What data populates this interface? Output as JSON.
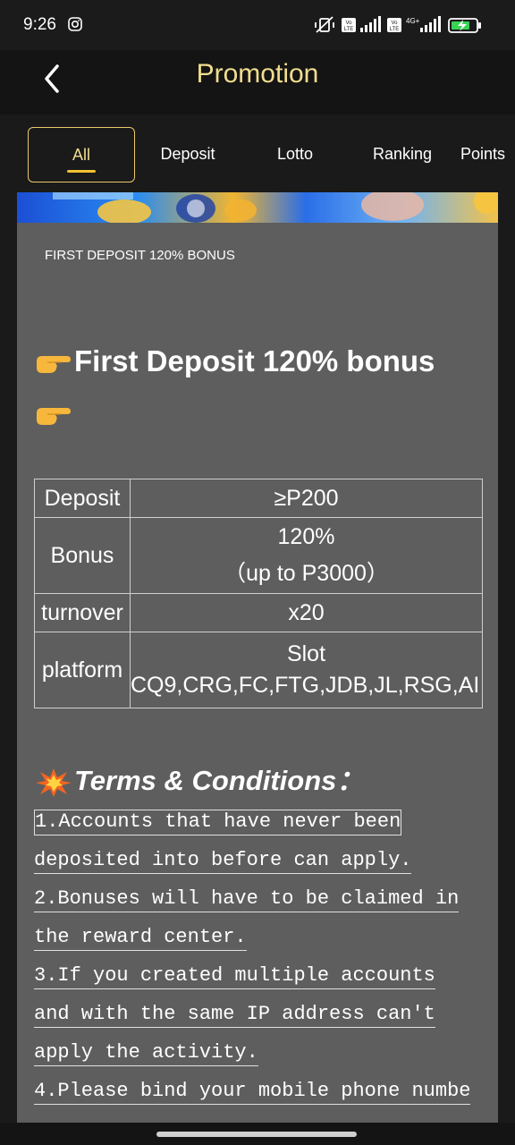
{
  "status_bar": {
    "time": "9:26"
  },
  "header": {
    "title": "Promotion",
    "title_color": "#f1dd8f"
  },
  "tabs": [
    {
      "label": "All",
      "active": true
    },
    {
      "label": "Deposit",
      "active": false
    },
    {
      "label": "Lotto",
      "active": false
    },
    {
      "label": "Ranking",
      "active": false
    },
    {
      "label": "Points",
      "active": false
    }
  ],
  "promo": {
    "heading": "FIRST DEPOSIT 120% BONUS",
    "title": "First Deposit 120% bonus",
    "table": {
      "deposit_label": "Deposit",
      "deposit_value": "≥P200",
      "bonus_label": "Bonus",
      "bonus_value_line1": "120%",
      "bonus_value_line2": "（up to P3000）",
      "turnover_label": "turnover",
      "turnover_value": "x20",
      "platform_label": "platform",
      "platform_value_line1": "Slot",
      "platform_value_line2": "CQ9,CRG,FC,FTG,JDB,JL,RSG,AI"
    },
    "terms_title": "Terms & Conditions：",
    "terms_lines": [
      "1.Accounts that have never been",
      "deposited into before can apply.",
      "2.Bonuses will have to be claimed in",
      "the reward center.",
      "3.If you created multiple accounts",
      "and with the same IP address can't",
      "apply the activity.",
      "4.Please bind your mobile phone numbe"
    ]
  },
  "colors": {
    "accent": "#f1dd8f",
    "card_bg": "#5e5e5e",
    "app_bg": "#1a1a1a"
  }
}
